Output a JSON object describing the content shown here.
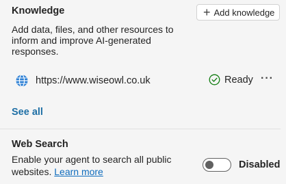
{
  "knowledge": {
    "title": "Knowledge",
    "add_button_label": "Add knowledge",
    "description_lines": [
      "Add data, files, and other resources to",
      "inform and improve AI-generated",
      "responses."
    ],
    "items": [
      {
        "url": "https://www.wiseowl.co.uk",
        "status": "Ready",
        "status_icon": "check-circle-icon",
        "more_label": "···"
      }
    ],
    "see_all_label": "See all"
  },
  "web_search": {
    "title": "Web Search",
    "description_line1": "Enable your agent to search all public",
    "description_line2_prefix": "websites.",
    "learn_more_label": "Learn more",
    "toggle_state_label": "Disabled",
    "enabled": false
  },
  "colors": {
    "background": "#f5f5f5",
    "link": "#0f6cbd",
    "see_all": "#1e6fa5",
    "ready_green": "#107c10"
  }
}
